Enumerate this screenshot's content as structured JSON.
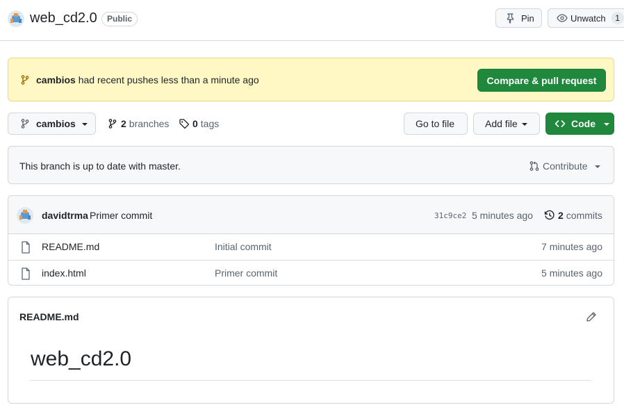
{
  "header": {
    "repo_name": "web_cd2.0",
    "visibility": "Public",
    "pin_label": "Pin",
    "watch_label": "Unwatch",
    "watch_count": "1"
  },
  "banner": {
    "branch": "cambios",
    "message": "had recent pushes less than a minute ago",
    "compare_label": "Compare & pull request"
  },
  "toolbar": {
    "current_branch": "cambios",
    "branches_count": "2",
    "branches_label": "branches",
    "tags_count": "0",
    "tags_label": "tags",
    "goto_label": "Go to file",
    "addfile_label": "Add file",
    "code_label": "Code"
  },
  "status": {
    "text": "This branch is up to date with master.",
    "contribute_label": "Contribute"
  },
  "latest_commit": {
    "author": "davidtrma",
    "message": "Primer commit",
    "hash": "31c9ce2",
    "time": "5 minutes ago",
    "commits_count": "2",
    "commits_label": "commits"
  },
  "files": [
    {
      "name": "README.md",
      "commit": "Initial commit",
      "age": "7 minutes ago"
    },
    {
      "name": "index.html",
      "commit": "Primer commit",
      "age": "5 minutes ago"
    }
  ],
  "readme": {
    "title": "README.md",
    "heading": "web_cd2.0"
  },
  "colors": {
    "primary_green": "#1f883d",
    "banner_yellow": "#fff8c5",
    "border": "#d0d7de",
    "muted_text": "#59636e"
  }
}
